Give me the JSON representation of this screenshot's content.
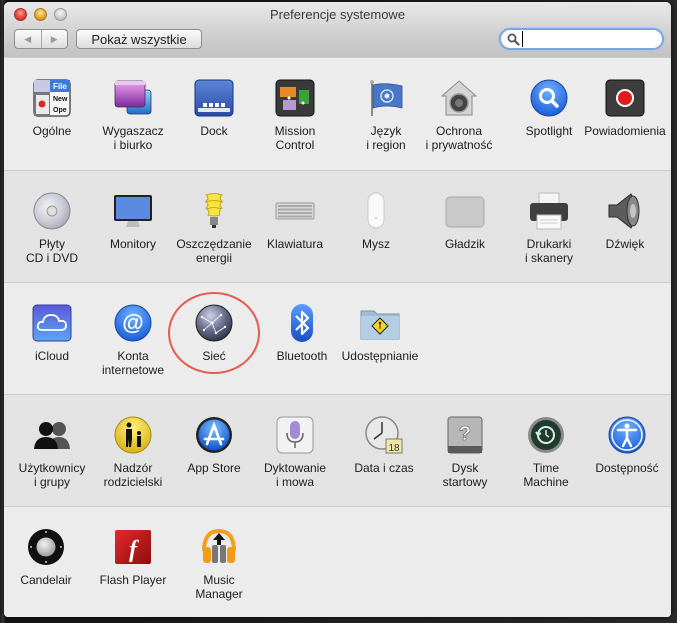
{
  "window": {
    "title": "Preferencje systemowe",
    "back_label": "◀",
    "forward_label": "▶",
    "show_all_label": "Pokaż wszystkie",
    "search_value": "",
    "search_placeholder": ""
  },
  "sections": [
    {
      "items": [
        {
          "id": "general",
          "icon": "general-icon",
          "label": "Ogólne"
        },
        {
          "id": "desktop",
          "icon": "desktop-screensaver-icon",
          "label": "Wygaszacz\ni biurko"
        },
        {
          "id": "dock",
          "icon": "dock-icon",
          "label": "Dock"
        },
        {
          "id": "mission",
          "icon": "mission-control-icon",
          "label": "Mission\nControl"
        },
        {
          "id": "language",
          "icon": "flag-icon",
          "label": "Język\ni region"
        },
        {
          "id": "security",
          "icon": "security-house-icon",
          "label": "Ochrona\ni prywatność"
        },
        {
          "id": "spotlight",
          "icon": "spotlight-icon",
          "label": "Spotlight"
        },
        {
          "id": "notifications",
          "icon": "notifications-icon",
          "label": "Powiadomienia"
        }
      ]
    },
    {
      "items": [
        {
          "id": "cd",
          "icon": "cd-dvd-icon",
          "label": "Płyty\nCD i DVD"
        },
        {
          "id": "displays",
          "icon": "monitor-icon",
          "label": "Monitory"
        },
        {
          "id": "energy",
          "icon": "lightbulb-icon",
          "label": "Oszczędzanie\nenergii"
        },
        {
          "id": "keyboard",
          "icon": "keyboard-icon",
          "label": "Klawiatura"
        },
        {
          "id": "mouse",
          "icon": "mouse-icon",
          "label": "Mysz"
        },
        {
          "id": "trackpad",
          "icon": "trackpad-icon",
          "label": "Gładzik"
        },
        {
          "id": "printers",
          "icon": "printer-icon",
          "label": "Drukarki\ni skanery"
        },
        {
          "id": "sound",
          "icon": "speaker-icon",
          "label": "Dźwięk"
        }
      ]
    },
    {
      "items": [
        {
          "id": "icloud",
          "icon": "icloud-icon",
          "label": "iCloud"
        },
        {
          "id": "internet",
          "icon": "at-sign-icon",
          "label": "Konta\ninternetowe"
        },
        {
          "id": "network",
          "icon": "network-globe-icon",
          "label": "Sieć",
          "highlighted": true
        },
        {
          "id": "bluetooth",
          "icon": "bluetooth-icon",
          "label": "Bluetooth"
        },
        {
          "id": "sharing",
          "icon": "sharing-folder-icon",
          "label": "Udostępnianie"
        }
      ]
    },
    {
      "items": [
        {
          "id": "users",
          "icon": "users-icon",
          "label": "Użytkownicy\ni grupy"
        },
        {
          "id": "parental",
          "icon": "parental-controls-icon",
          "label": "Nadzór\nrodzicielski"
        },
        {
          "id": "appstore",
          "icon": "app-store-icon",
          "label": "App Store"
        },
        {
          "id": "dictation",
          "icon": "microphone-icon",
          "label": "Dyktowanie\ni mowa"
        },
        {
          "id": "datetime",
          "icon": "clock-calendar-icon",
          "label": "Data i czas",
          "badge": "18"
        },
        {
          "id": "startup",
          "icon": "startup-disk-icon",
          "label": "Dysk\nstartowy"
        },
        {
          "id": "timemachine",
          "icon": "time-machine-icon",
          "label": "Time\nMachine"
        },
        {
          "id": "accessibility",
          "icon": "accessibility-icon",
          "label": "Dostępność"
        }
      ]
    },
    {
      "items": [
        {
          "id": "candelair",
          "icon": "candelair-remote-icon",
          "label": "Candelair"
        },
        {
          "id": "flash",
          "icon": "flash-player-icon",
          "label": "Flash Player"
        },
        {
          "id": "musicmanager",
          "icon": "music-manager-headphones-icon",
          "label": "Music\nManager"
        }
      ]
    }
  ],
  "general_icon_menu": [
    "File",
    "New",
    "Ope"
  ],
  "colors": {
    "highlight_ring": "#e85a50",
    "search_focus": "#7aa6de"
  }
}
